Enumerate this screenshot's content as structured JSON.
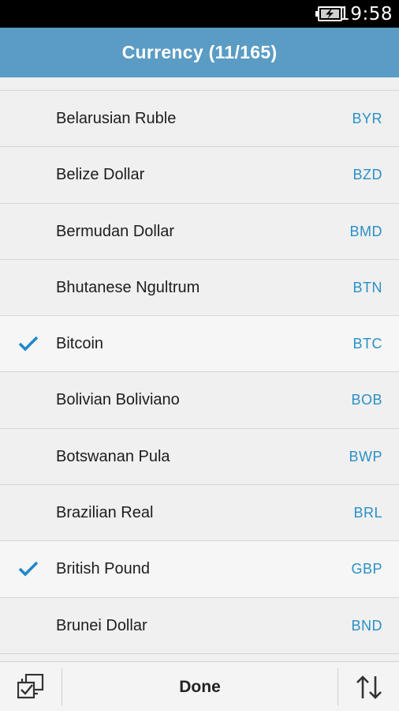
{
  "status_bar": {
    "time": "19:58",
    "battery_icon": "battery-charging-icon"
  },
  "header": {
    "title": "Currency (11/165)"
  },
  "currencies": [
    {
      "name": "Belarusian Ruble",
      "code": "BYR",
      "selected": false
    },
    {
      "name": "Belize Dollar",
      "code": "BZD",
      "selected": false
    },
    {
      "name": "Bermudan Dollar",
      "code": "BMD",
      "selected": false
    },
    {
      "name": "Bhutanese Ngultrum",
      "code": "BTN",
      "selected": false
    },
    {
      "name": "Bitcoin",
      "code": "BTC",
      "selected": true
    },
    {
      "name": "Bolivian Boliviano",
      "code": "BOB",
      "selected": false
    },
    {
      "name": "Botswanan Pula",
      "code": "BWP",
      "selected": false
    },
    {
      "name": "Brazilian Real",
      "code": "BRL",
      "selected": false
    },
    {
      "name": "British Pound",
      "code": "GBP",
      "selected": true
    },
    {
      "name": "Brunei Dollar",
      "code": "BND",
      "selected": false
    }
  ],
  "bottom_bar": {
    "select_all_icon": "select-all-icon",
    "done_label": "Done",
    "sort_icon": "sort-icon"
  },
  "colors": {
    "header_bg": "#5b9cc4",
    "accent": "#2a8fc6",
    "check": "#1e88c8"
  }
}
